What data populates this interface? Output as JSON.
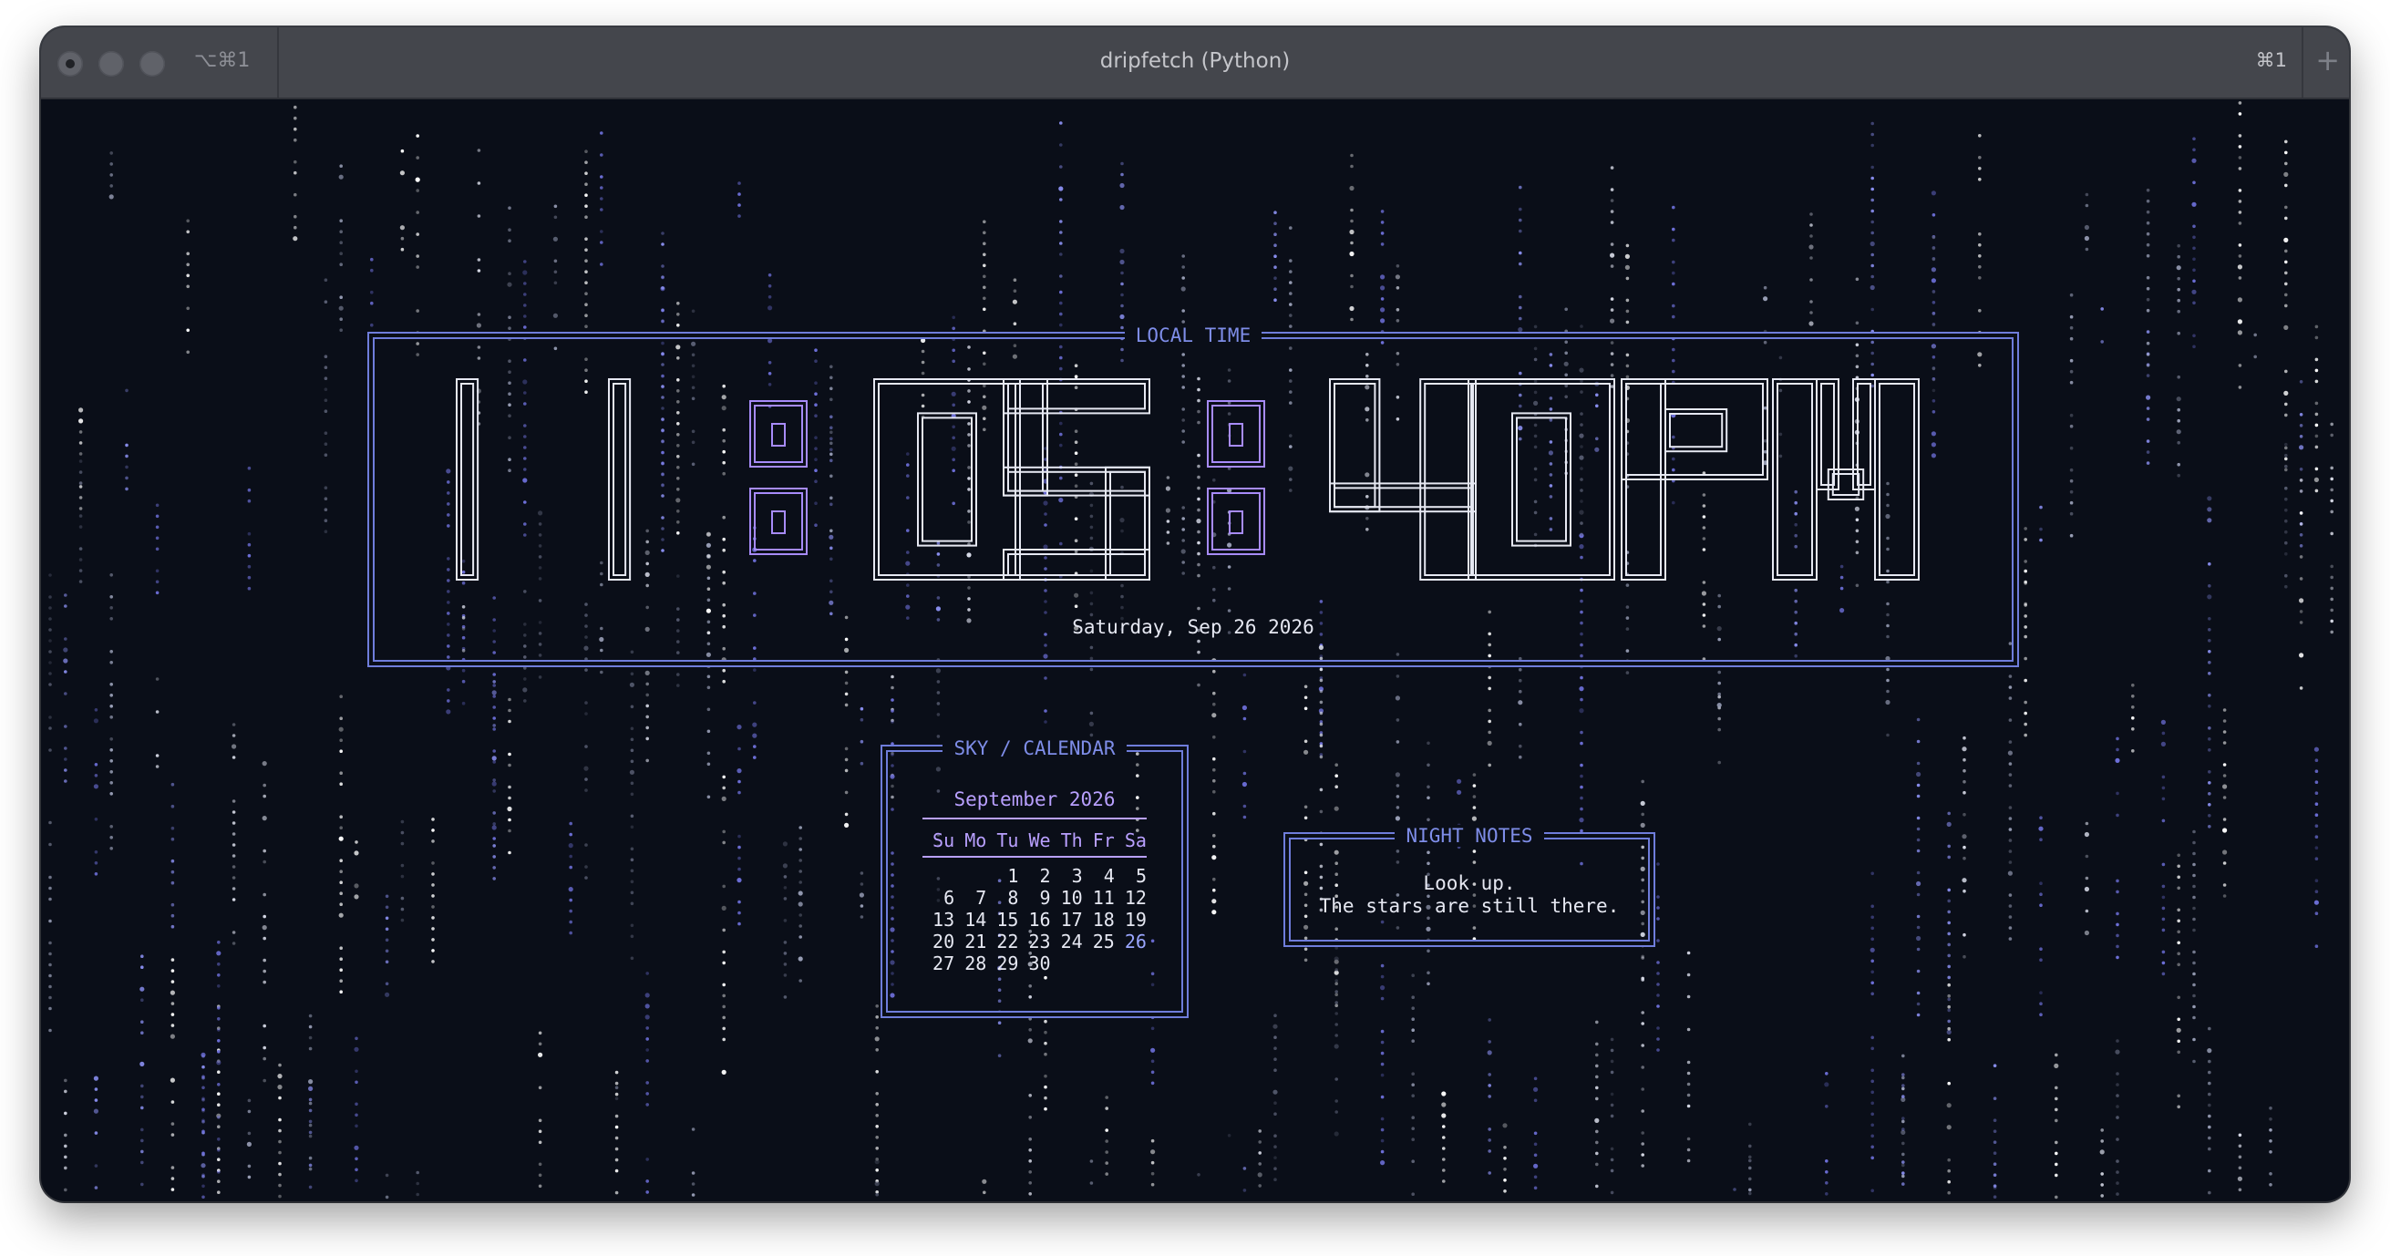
{
  "window": {
    "title": "dripfetch (Python)",
    "tab_shortcut": "⌥⌘1",
    "right_shortcut": "⌘1",
    "new_tab_label": "+"
  },
  "colors": {
    "background": "#0a0e18",
    "frame": "#6f7ddb",
    "frame_title": "#7e8de8",
    "digits": "#e6e8f2",
    "colons": "#a78bfa",
    "calendar_accent": "#b9a0ff",
    "today": "#9aa6ff"
  },
  "clock": {
    "panel_title": "LOCAL TIME",
    "time_glyphs": [
      "1",
      "1",
      ":",
      "0",
      "5",
      ":",
      "4",
      "0",
      "P",
      "M"
    ],
    "date": "Saturday, Sep 26 2026"
  },
  "calendar": {
    "panel_title": "SKY / CALENDAR",
    "month": "September 2026",
    "weekdays": [
      "Su",
      "Mo",
      "Tu",
      "We",
      "Th",
      "Fr",
      "Sa"
    ],
    "leading_blanks": 2,
    "days": [
      "1",
      "2",
      "3",
      "4",
      "5",
      "6",
      "7",
      "8",
      "9",
      "10",
      "11",
      "12",
      "13",
      "14",
      "15",
      "16",
      "17",
      "18",
      "19",
      "20",
      "21",
      "22",
      "23",
      "24",
      "25",
      "26",
      "27",
      "28",
      "29",
      "30"
    ],
    "today": "26"
  },
  "notes": {
    "panel_title": "NIGHT NOTES",
    "lines": [
      "Look up.",
      "The stars are still there."
    ]
  }
}
